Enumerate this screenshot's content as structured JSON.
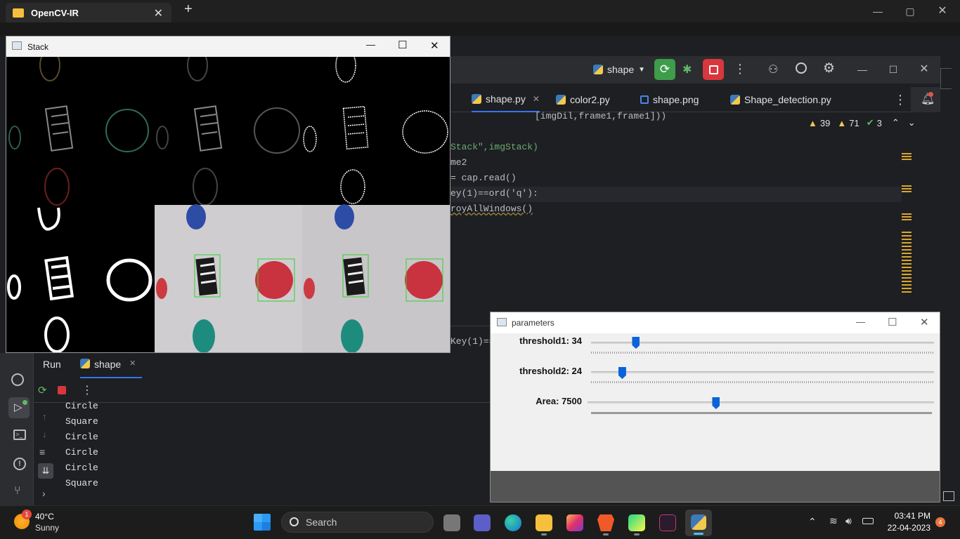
{
  "explorer": {
    "tab_title": "OpenCV-IR",
    "close": "✕",
    "new_tab": "+",
    "min": "—",
    "max": "▢",
    "close_win": "✕"
  },
  "stack_window": {
    "title": "Stack",
    "min": "—",
    "max": "☐",
    "close": "✕"
  },
  "ide": {
    "run_config": "shape",
    "tabs": [
      {
        "label": "shape.py",
        "close": "✕"
      },
      {
        "label": "color2.py"
      },
      {
        "label": "shape.png"
      },
      {
        "label": "Shape_detection.py"
      }
    ],
    "inspections": {
      "warnings": "39",
      "weak": "71",
      "ok": "3"
    },
    "code_lines": [
      "[imgDil,frame1,frame1]))",
      "Stack\",imgStack)",
      "me2",
      "= cap.read()",
      "ey(1)==ord('q'):",
      "royAllWindows()"
    ],
    "breadcrumb": "Key(1)=="
  },
  "run_panel": {
    "tab_run": "Run",
    "tab_shape": "shape",
    "tab_close": "✕",
    "console": [
      "Circle",
      "Square",
      "Circle",
      "Circle",
      "Circle",
      "Square"
    ]
  },
  "parameters": {
    "title": "parameters",
    "min": "—",
    "max": "☐",
    "close": "✕",
    "sliders": [
      {
        "label": "threshold1: 34",
        "fraction": 0.13
      },
      {
        "label": "threshold2: 24",
        "fraction": 0.09
      },
      {
        "label": "Area: 7500",
        "fraction": 0.37
      }
    ]
  },
  "taskbar": {
    "temp": "40°C",
    "weather": "Sunny",
    "weather_badge": "1",
    "search": "Search",
    "time": "03:41 PM",
    "date": "22-04-2023",
    "notif_count": "4"
  },
  "colors": {
    "accent_blue": "#0a64d8",
    "run_green": "#3e9c4b",
    "stop_red": "#d9363e",
    "ide_bg": "#1e1f22"
  }
}
